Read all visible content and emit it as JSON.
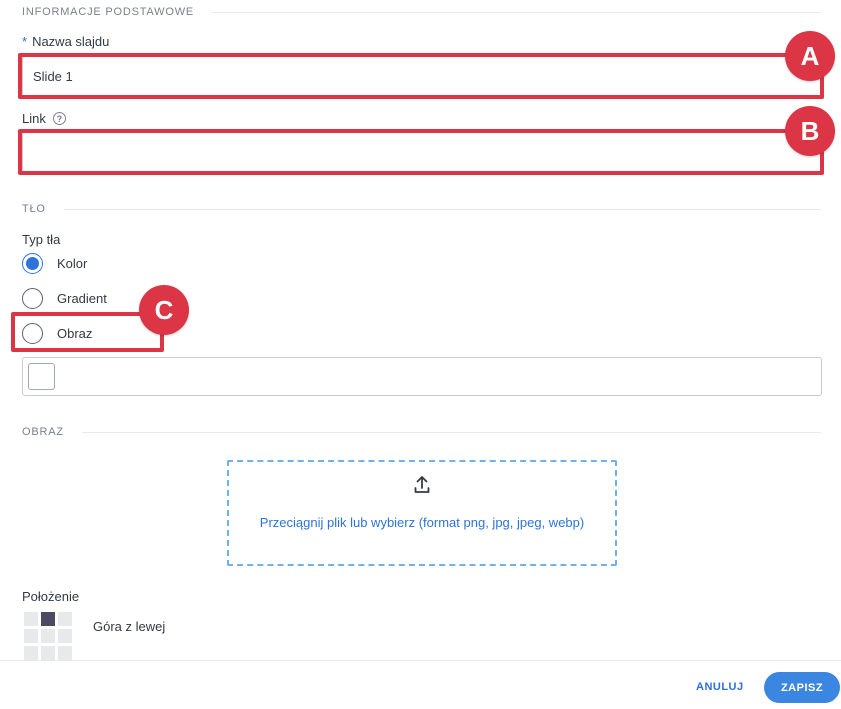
{
  "sections": {
    "basic": {
      "title": "INFORMACJE PODSTAWOWE"
    },
    "background": {
      "title": "TŁO"
    },
    "image": {
      "title": "OBRAZ"
    }
  },
  "fields": {
    "slide_name": {
      "required_mark": "*",
      "label": "Nazwa slajdu",
      "value": "Slide 1"
    },
    "link": {
      "label": "Link",
      "help_glyph": "?",
      "value": ""
    }
  },
  "background_type": {
    "label": "Typ tła",
    "options": [
      "Kolor",
      "Gradient",
      "Obraz"
    ],
    "selected": "Kolor"
  },
  "upload": {
    "text": "Przeciągnij plik lub wybierz (format png, jpg, jpeg, webp)",
    "icon": "upload-icon"
  },
  "position": {
    "label": "Położenie",
    "value": "Góra z lewej",
    "active_cell": 1
  },
  "footer": {
    "cancel_label": "ANULUJ",
    "save_label": "ZAPISZ"
  },
  "annotations": [
    "A",
    "B",
    "C"
  ],
  "colors": {
    "accent": "#3b86e1",
    "highlight": "#dc3545",
    "link": "#2c6fd6"
  }
}
